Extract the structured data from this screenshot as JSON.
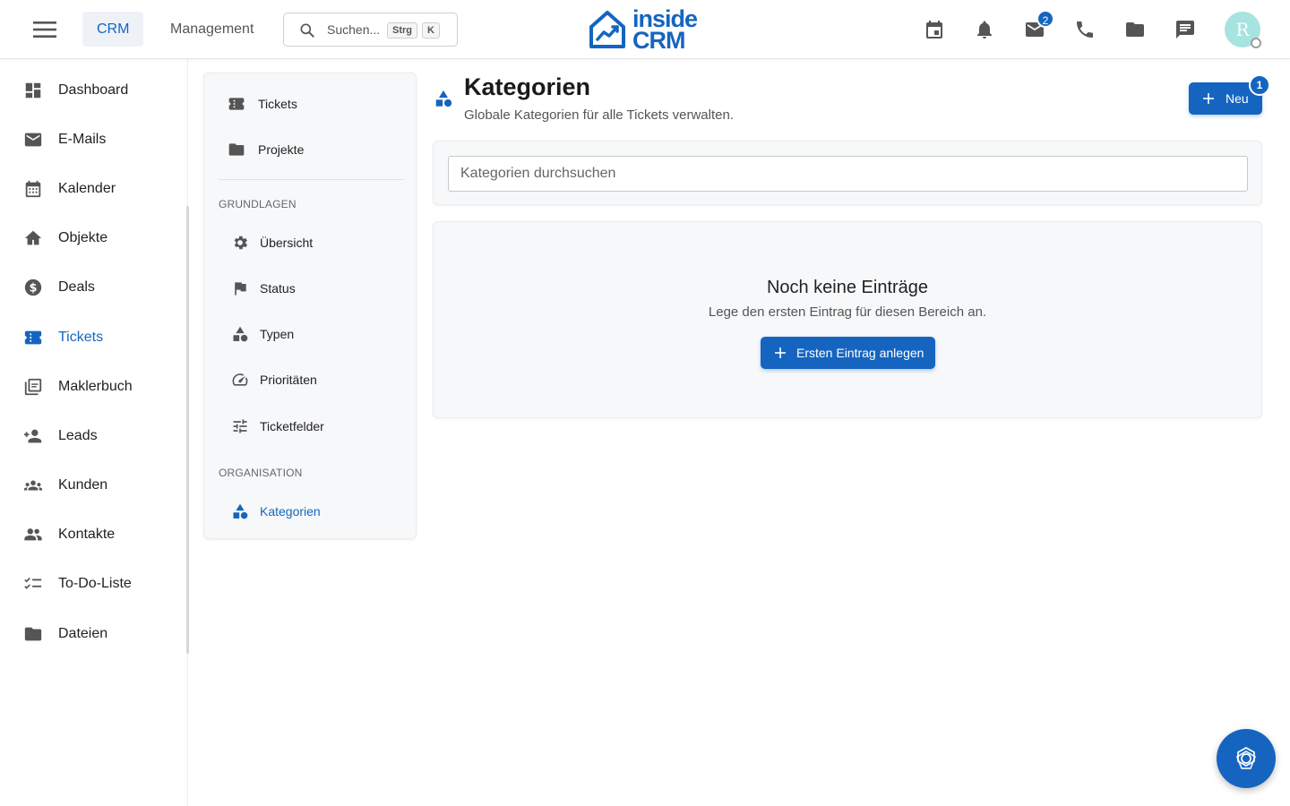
{
  "header": {
    "menu_icon": "hamburger-icon",
    "tabs": [
      {
        "label": "CRM",
        "active": true
      },
      {
        "label": "Management",
        "active": false
      }
    ],
    "search": {
      "placeholder": "Suchen...",
      "kbd_ctrl": "Strg",
      "kbd_key": "K"
    },
    "logo": {
      "line1": "inside",
      "line2": "CRM"
    },
    "icons": [
      "calendar-icon",
      "bell-icon",
      "mail-icon",
      "phone-icon",
      "folder-icon",
      "chat-icon"
    ],
    "mail_badge": "2",
    "avatar_initial": "R"
  },
  "sidebar": {
    "items": [
      {
        "label": "Dashboard",
        "icon": "dashboard-icon",
        "active": false
      },
      {
        "label": "E-Mails",
        "icon": "mail-icon",
        "active": false
      },
      {
        "label": "Kalender",
        "icon": "calendar-icon",
        "active": false
      },
      {
        "label": "Objekte",
        "icon": "home-icon",
        "active": false
      },
      {
        "label": "Deals",
        "icon": "dollar-icon",
        "active": false
      },
      {
        "label": "Tickets",
        "icon": "ticket-icon",
        "active": true
      },
      {
        "label": "Maklerbuch",
        "icon": "library-icon",
        "active": false
      },
      {
        "label": "Leads",
        "icon": "person-add-icon",
        "active": false
      },
      {
        "label": "Kunden",
        "icon": "groups-icon",
        "active": false
      },
      {
        "label": "Kontakte",
        "icon": "people-icon",
        "active": false
      },
      {
        "label": "To-Do-Liste",
        "icon": "checklist-icon",
        "active": false
      },
      {
        "label": "Dateien",
        "icon": "folder-icon",
        "active": false
      }
    ]
  },
  "submenu": {
    "top_items": [
      {
        "label": "Tickets",
        "icon": "ticket-icon"
      },
      {
        "label": "Projekte",
        "icon": "folder-icon"
      }
    ],
    "section_grundlagen": "GRUNDLAGEN",
    "grundlagen_items": [
      {
        "label": "Übersicht",
        "icon": "gear-icon"
      },
      {
        "label": "Status",
        "icon": "flag-icon"
      },
      {
        "label": "Typen",
        "icon": "category-icon"
      },
      {
        "label": "Prioritäten",
        "icon": "speed-icon"
      },
      {
        "label": "Ticketfelder",
        "icon": "tune-icon"
      }
    ],
    "section_organisation": "ORGANISATION",
    "organisation_items": [
      {
        "label": "Kategorien",
        "icon": "category-icon",
        "active": true
      }
    ]
  },
  "main": {
    "title": "Kategorien",
    "subtitle": "Globale Kategorien für alle Tickets verwalten.",
    "new_button": "Neu",
    "new_badge": "1",
    "search_placeholder": "Kategorien durchsuchen",
    "empty_title": "Noch keine Einträge",
    "empty_subtitle": "Lege den ersten Eintrag für diesen Bereich an.",
    "empty_button": "Ersten Eintrag anlegen"
  },
  "fab_icon": "assistant-icon",
  "colors": {
    "accent": "#1565c0",
    "avatar_bg": "#a7e3df",
    "icon": "#555555"
  }
}
